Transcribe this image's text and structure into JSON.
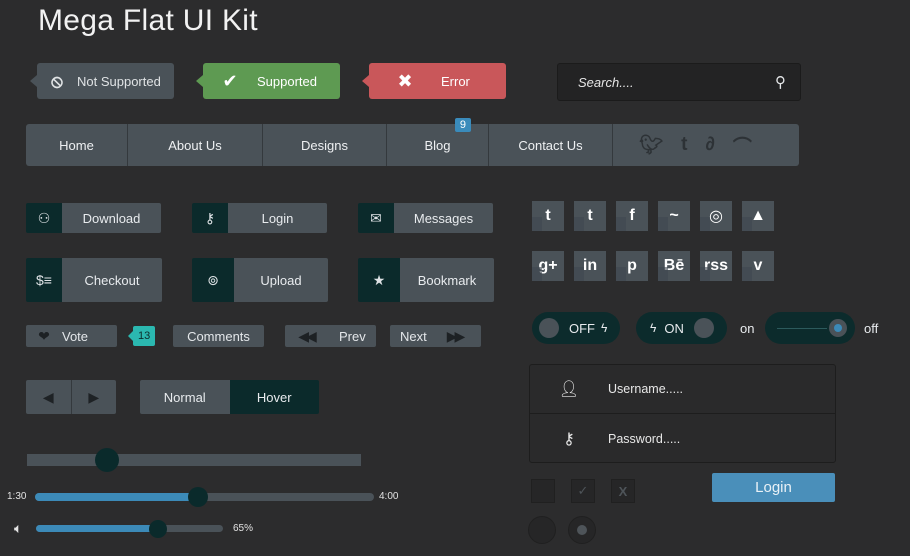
{
  "title": "Mega Flat UI Kit",
  "tags": {
    "not_supported": "Not Supported",
    "supported": "Supported",
    "error": "Error"
  },
  "search": {
    "placeholder": "Search....",
    "icon": "search-icon"
  },
  "nav": {
    "items": [
      "Home",
      "About Us",
      "Designs",
      "Blog",
      "Contact Us"
    ],
    "blog_badge": "9",
    "social": [
      "twitter-icon",
      "tumblr-icon",
      "deviantart-icon",
      "rss-icon"
    ]
  },
  "buttons": {
    "download": "Download",
    "login": "Login",
    "messages": "Messages",
    "checkout": "Checkout",
    "upload": "Upload",
    "bookmark": "Bookmark",
    "vote": "Vote",
    "vote_count": "13",
    "comments": "Comments",
    "prev": "Prev",
    "next": "Next",
    "normal": "Normal",
    "hover": "Hover"
  },
  "social_tiles": [
    "t",
    "t",
    "f",
    "~",
    "◎",
    "▲",
    "g+",
    "in",
    "p",
    "Bē",
    "rss",
    "v"
  ],
  "toggles": {
    "off_label": "OFF",
    "on_label": "ON",
    "slider_on": "on",
    "slider_off": "off"
  },
  "login_form": {
    "username_placeholder": "Username.....",
    "password_placeholder": "Password.....",
    "submit": "Login"
  },
  "sliders": {
    "plain_level": 0.24,
    "video": {
      "start": "1:30",
      "end": "4:00",
      "progress": 0.48
    },
    "volume": {
      "label": "65%",
      "progress": 0.65
    }
  },
  "colors": {
    "accent": "#3c8ab8",
    "success": "#5e9a52",
    "error": "#c9575a",
    "teal": "#2bb8b0",
    "dark": "#0b2a2b"
  }
}
